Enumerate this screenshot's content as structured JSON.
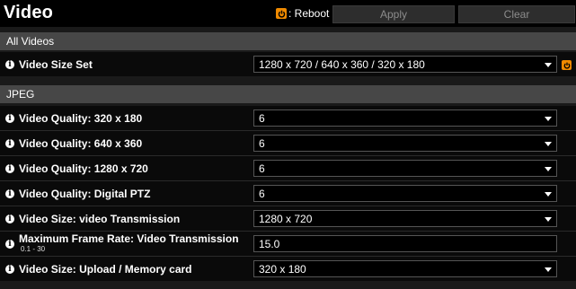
{
  "header": {
    "title": "Video",
    "reboot_legend": ": Reboot",
    "apply_label": "Apply",
    "clear_label": "Clear"
  },
  "colors": {
    "reboot_accent": "#f08a00",
    "section_bar": "#474747",
    "row_background": "#0a0a0a",
    "button_text": "#8c8c8c"
  },
  "sections": {
    "all_videos": {
      "title": "All Videos",
      "rows": [
        {
          "label": "Video Size Set",
          "value": "1280 x 720 / 640 x 360 / 320 x 180",
          "control": "select",
          "requires_reboot": true,
          "icon": "info-icon"
        }
      ]
    },
    "jpeg": {
      "title": "JPEG",
      "rows": [
        {
          "label": "Video Quality: 320 x 180",
          "value": "6",
          "control": "select",
          "icon": "info-icon"
        },
        {
          "label": "Video Quality: 640 x 360",
          "value": "6",
          "control": "select",
          "icon": "info-icon"
        },
        {
          "label": "Video Quality: 1280 x 720",
          "value": "6",
          "control": "select",
          "icon": "info-icon"
        },
        {
          "label": "Video Quality: Digital PTZ",
          "value": "6",
          "control": "select",
          "icon": "info-icon"
        },
        {
          "label": "Video Size: video Transmission",
          "value": "1280 x 720",
          "control": "select",
          "icon": "info-icon"
        },
        {
          "label": "Maximum Frame Rate: Video Transmission",
          "sub_label": "0.1 - 30",
          "value": "15.0",
          "control": "input",
          "icon": "info-icon"
        },
        {
          "label": "Video Size: Upload / Memory card",
          "value": "320 x 180",
          "control": "select",
          "icon": "info-icon"
        }
      ]
    }
  }
}
